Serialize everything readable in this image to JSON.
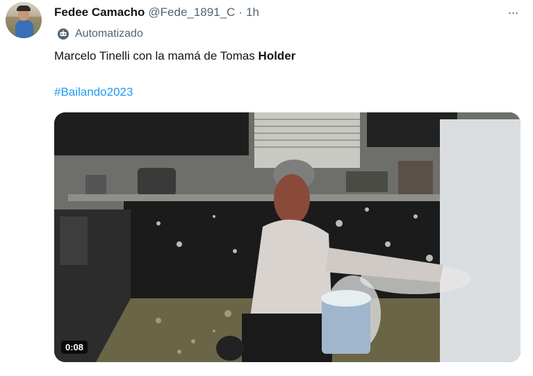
{
  "author": {
    "display_name": "Fedee Camacho",
    "handle": "@Fede_1891_C",
    "separator": "·",
    "time": "1h",
    "avatar_icon": "profile-photo"
  },
  "label": {
    "icon": "bot-icon",
    "text": "Automatizado"
  },
  "tweet": {
    "text_prefix": "Marcelo Tinelli con la mamá de Tomas ",
    "text_bold": "Holder",
    "hashtag": "#Bailando2023"
  },
  "media": {
    "type": "video",
    "duration": "0:08"
  },
  "more_menu": {
    "icon": "more-horizontal-icon",
    "glyph": "···"
  },
  "colors": {
    "text_primary": "#0f1419",
    "text_secondary": "#536471",
    "link": "#1d9bf0"
  }
}
